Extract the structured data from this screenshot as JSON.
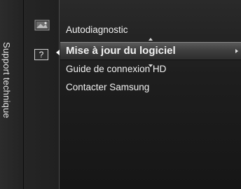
{
  "window": {
    "side_title": "Support technique"
  },
  "category_icons": [
    {
      "name": "picture-icon"
    },
    {
      "name": "support-icon",
      "glyph": "?",
      "selected": true
    }
  ],
  "menu": {
    "items": [
      {
        "label": "Autodiagnostic",
        "selected": false,
        "has_submenu": false
      },
      {
        "label": "Mise à jour du logiciel",
        "selected": true,
        "has_submenu": true
      },
      {
        "label": "Guide de connexion HD",
        "selected": false,
        "has_submenu": false
      },
      {
        "label": "Contacter Samsung",
        "selected": false,
        "has_submenu": false
      }
    ]
  },
  "colors": {
    "background": "#1b1b1b",
    "text": "#ffffff",
    "selected_band": "#4a4a4a"
  }
}
